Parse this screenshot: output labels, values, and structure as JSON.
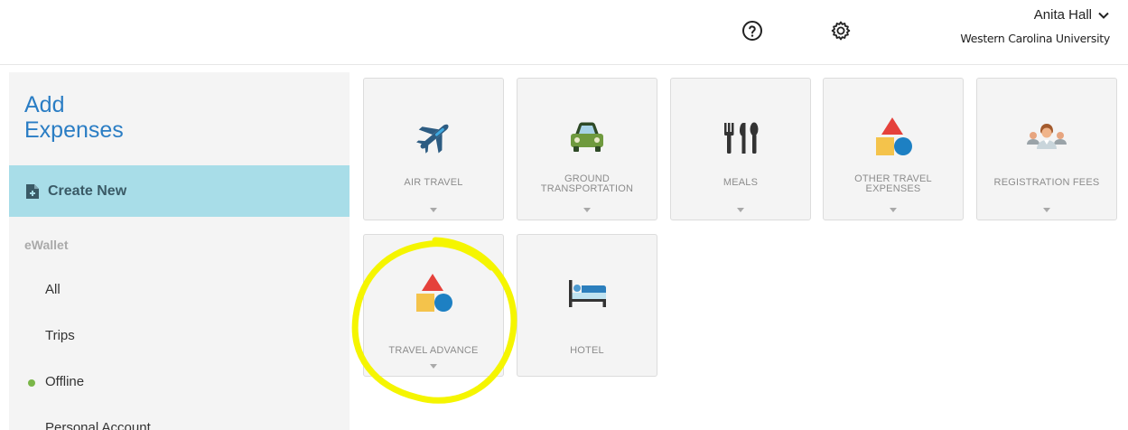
{
  "header": {
    "user_name": "Anita Hall",
    "organization": "Western Carolina University",
    "icons": [
      "help-icon",
      "gear-icon",
      "chevron-down-icon"
    ]
  },
  "sidebar": {
    "title_line1": "Add",
    "title_line2": "Expenses",
    "create_new": "Create New",
    "section_label": "eWallet",
    "items": [
      "All",
      "Trips",
      "Offline",
      "Personal Account"
    ]
  },
  "tiles": [
    {
      "label": "AIR TRAVEL",
      "icon": "airplane-icon"
    },
    {
      "label_line1": "GROUND",
      "label_line2": "TRANSPORTATION",
      "icon": "car-icon"
    },
    {
      "label": "MEALS",
      "icon": "utensils-icon"
    },
    {
      "label_line1": "OTHER TRAVEL",
      "label_line2": "EXPENSES",
      "icon": "shapes-icon"
    },
    {
      "label": "REGISTRATION FEES",
      "icon": "attendees-icon"
    },
    {
      "label": "TRAVEL ADVANCE",
      "icon": "shapes-icon"
    },
    {
      "label": "HOTEL",
      "icon": "bed-icon"
    }
  ],
  "colors": {
    "accent_blue": "#2a7dc4",
    "create_new_bg": "#a8dde8",
    "offline_dot": "#7ab648",
    "highlight": "#f5f500"
  }
}
